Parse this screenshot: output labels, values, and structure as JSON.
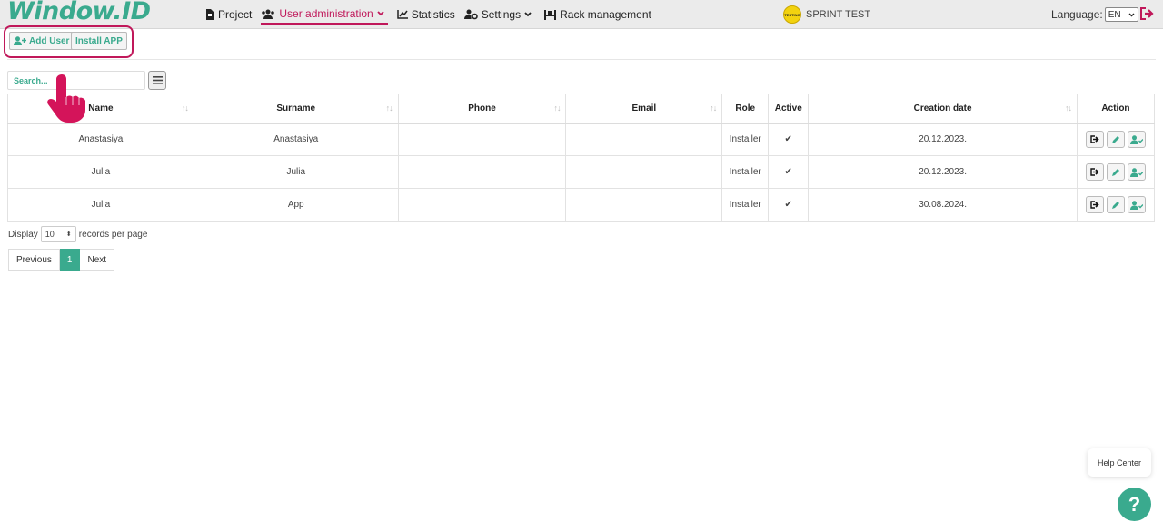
{
  "app": {
    "logo": "Window.ID"
  },
  "nav": {
    "project": "Project",
    "user_admin": "User administration",
    "statistics": "Statistics",
    "settings": "Settings",
    "rack": "Rack management"
  },
  "project_badge": {
    "name": "SPRINT TEST",
    "logo_text": "TESTING"
  },
  "language": {
    "label": "Language:",
    "value": "EN"
  },
  "toolbar": {
    "add_user": "Add User",
    "install_app": "Install APP"
  },
  "search": {
    "placeholder": "Search..."
  },
  "table": {
    "headers": [
      "Name",
      "Surname",
      "Phone",
      "Email",
      "Role",
      "Active",
      "Creation date",
      "Action"
    ],
    "rows": [
      {
        "name": "Anastasiya",
        "surname": "Anastasiya",
        "phone": "",
        "email": "",
        "role": "Installer",
        "active": "✔",
        "created": "20.12.2023."
      },
      {
        "name": "Julia",
        "surname": "Julia",
        "phone": "",
        "email": "",
        "role": "Installer",
        "active": "✔",
        "created": "20.12.2023."
      },
      {
        "name": "Julia",
        "surname": "App",
        "phone": "",
        "email": "",
        "role": "Installer",
        "active": "✔",
        "created": "30.08.2024."
      }
    ]
  },
  "pagination": {
    "display_label": "Display",
    "per_page": "10",
    "records_label": "records per page",
    "previous": "Previous",
    "current": "1",
    "next": "Next"
  },
  "help": {
    "label": "Help Center",
    "icon": "?"
  },
  "colors": {
    "accent": "#3aaa8e",
    "highlight": "#c0185a"
  }
}
